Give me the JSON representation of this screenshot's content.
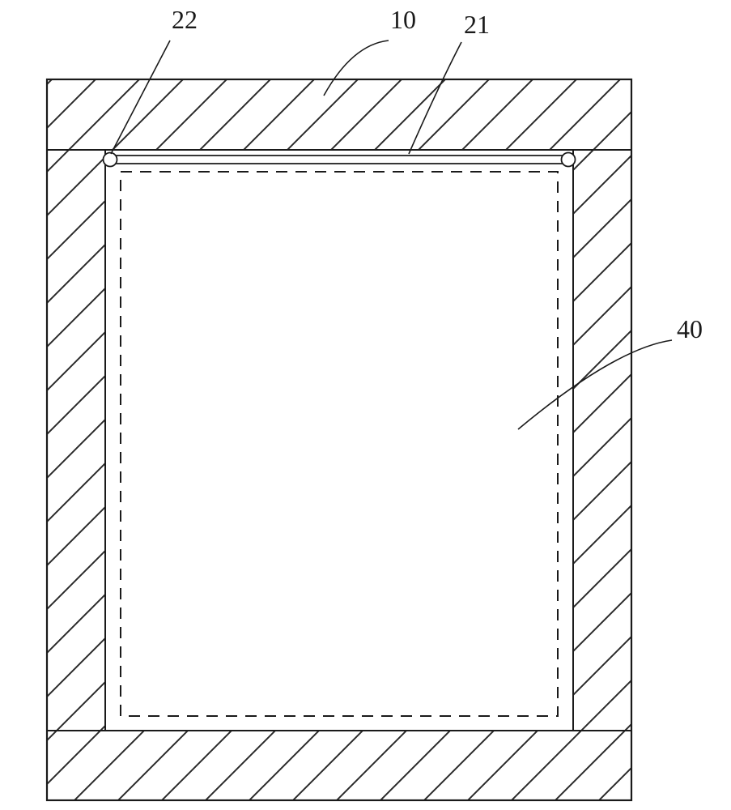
{
  "diagram": {
    "labels": {
      "top_left": "22",
      "top_mid": "10",
      "top_right": "21",
      "right_mid": "40"
    }
  }
}
